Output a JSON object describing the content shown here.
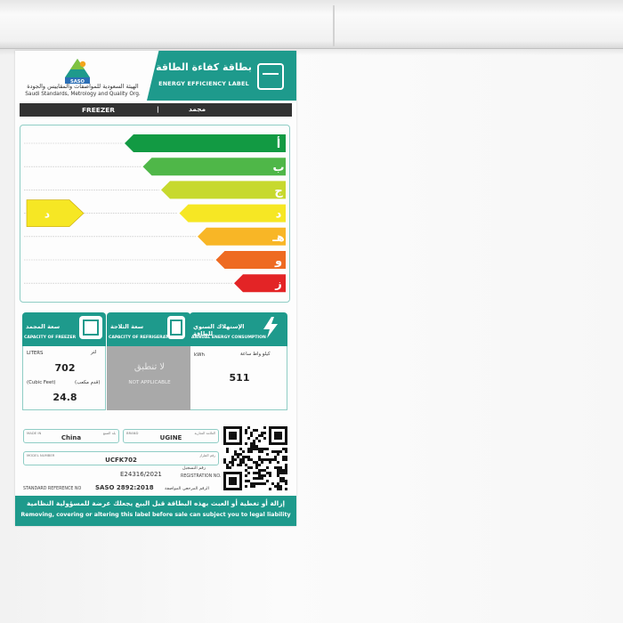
{
  "label": {
    "header": {
      "title_ar": "بطاقة كفاءة الطاقة",
      "title_en": "ENERGY EFFICIENCY LABEL",
      "org_ar": "الهيئة السعودية للمواصفات والمقاييس والجودة",
      "org_en": "Saudi Standards, Metrology and Quality Org.",
      "logo_text": "SASO"
    },
    "appliance": {
      "type_en": "FREEZER",
      "separator": "|",
      "type_ar": "مجمد"
    },
    "scale": {
      "classes": [
        "أ",
        "ب",
        "ج",
        "د",
        "هـ",
        "و",
        "ز"
      ],
      "colors": [
        "#129a43",
        "#4fb748",
        "#c7d92e",
        "#f6e724",
        "#f8b626",
        "#ee6b22",
        "#e32426"
      ],
      "rated_class": "د",
      "rated_color": "#f6e724"
    },
    "freezer_capacity": {
      "title_ar": "سعة المجمد",
      "title_en": "CAPACITY OF FREEZER",
      "unit_en": "LITERS",
      "unit_ar": "لتر",
      "liters": "702",
      "cubic_unit_en": "(Cubic Feet)",
      "cubic_unit_ar": "(قدم مكعب)",
      "cubic_feet": "24.8"
    },
    "fridge_capacity": {
      "title_ar": "سعة الثلاجة",
      "title_en": "CAPACITY OF REFRIGERATOR",
      "na_ar": "لا تنطبق",
      "na_en": "NOT APPLICABLE"
    },
    "energy": {
      "title_ar": "الإستهلاك السنوي للطاقة",
      "title_en": "ANNUAL ENERGY CONSUMPTION",
      "unit_en": "kWh",
      "unit_ar": "كيلو واط ساعة",
      "value": "511"
    },
    "details": {
      "origin_label": "MADE IN",
      "origin_label_ar": "بلد الصنع",
      "origin": "China",
      "brand_label": "BRAND",
      "brand_label_ar": "العلامة التجارية",
      "brand": "UGINE",
      "model_label": "MODEL NUMBER",
      "model_label_ar": "رقم الطراز",
      "model": "UCFK702",
      "registration_no": "E24316/2021",
      "registration_label_ar": "رقم التسجيل",
      "registration_label_en": "REGISTRATION NO.",
      "standard_label_en": "STANDARD REFERENCE NO",
      "standard": "SASO 2892:2018",
      "standard_label_ar": "الرقم المرجعي المواصفة"
    },
    "footer": {
      "warning_ar": "إزالة أو تغطية أو العبث بهذه البطاقة قبل البيع يجعلك عرضة للمسؤولية النظامية",
      "warning_en": "Removing, covering or altering this label before sale can subject you to legal liability"
    }
  }
}
